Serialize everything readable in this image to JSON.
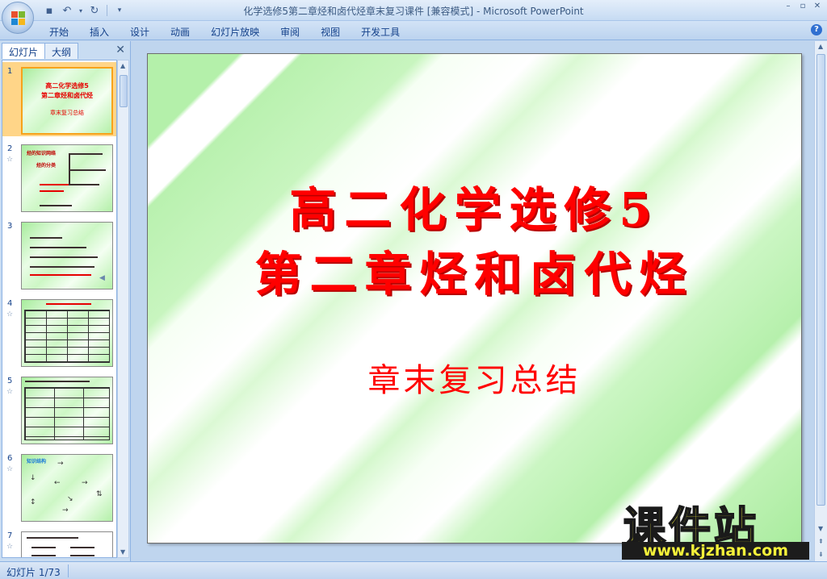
{
  "window": {
    "title": "化学选修5第二章烃和卤代烃章末复习课件 [兼容模式] - Microsoft PowerPoint",
    "controls": [
      "–",
      "▫",
      "✕"
    ]
  },
  "ribbon": {
    "tabs": [
      "开始",
      "插入",
      "设计",
      "动画",
      "幻灯片放映",
      "审阅",
      "视图",
      "开发工具"
    ],
    "help": "?"
  },
  "left_pane": {
    "tabs": [
      "幻灯片",
      "大纲"
    ],
    "close": "✕",
    "thumbnails": [
      {
        "num": "1",
        "lines": [
          "高二化学选修5",
          "第二章烃和卤代烃",
          "章末复习总结"
        ]
      },
      {
        "num": "2",
        "lines": [
          "烃的知识网络",
          "烃的分类"
        ]
      },
      {
        "num": "3",
        "lines": []
      },
      {
        "num": "4",
        "lines": []
      },
      {
        "num": "5",
        "lines": []
      },
      {
        "num": "6",
        "lines": [
          "知识结构"
        ]
      },
      {
        "num": "7",
        "lines": []
      }
    ]
  },
  "slide": {
    "title_line1": "高二化学选修5",
    "title_line2": "第二章烃和卤代烃",
    "subtitle": "章末复习总结"
  },
  "status": {
    "slide_indicator": "幻灯片 1/73"
  },
  "watermark": {
    "main": "课件站",
    "url": "www.kjzhan.com"
  },
  "colors": {
    "slide_text": "#ff0000",
    "selected_thumb": "#ffd588",
    "watermark_yellow": "#f5f23a"
  }
}
